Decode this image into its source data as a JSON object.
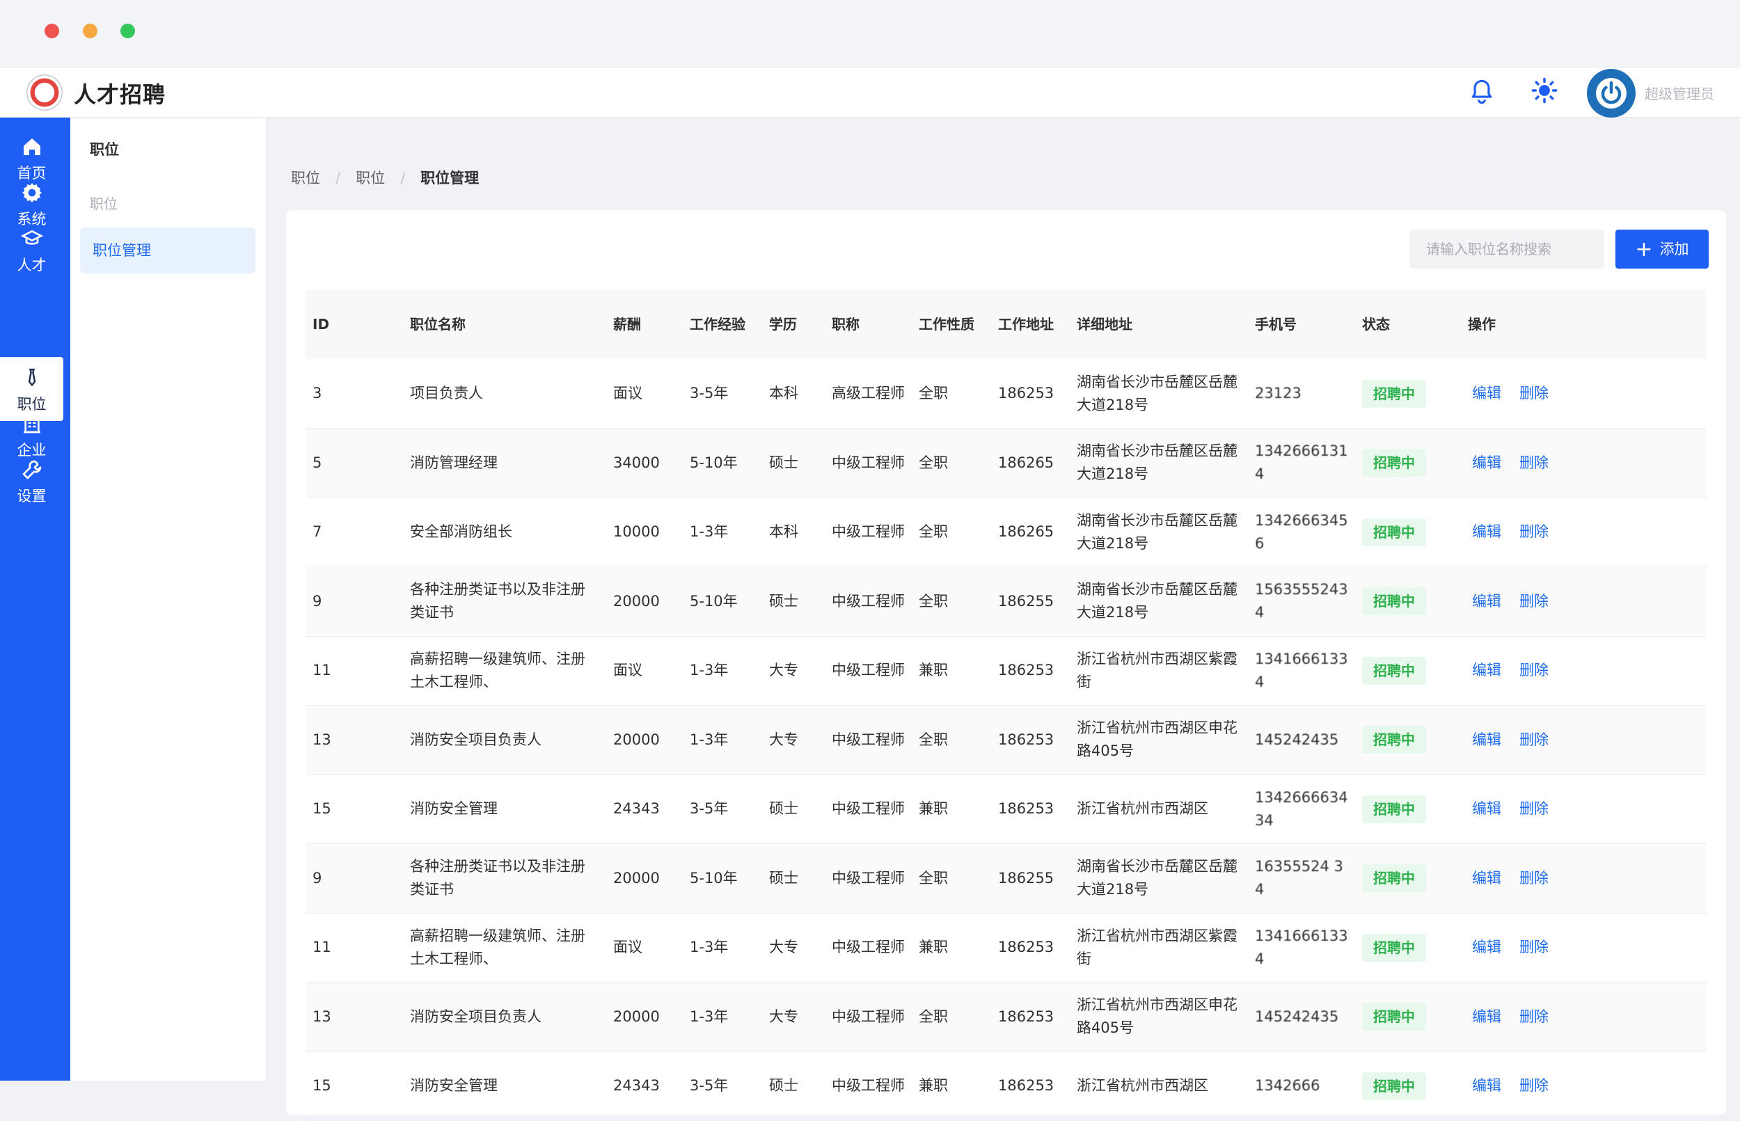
{
  "window": {
    "title": ""
  },
  "header": {
    "app_title": "人才招聘",
    "user_name": "超级管理员"
  },
  "rail": {
    "items": [
      {
        "label": "首页",
        "icon": "home-icon"
      },
      {
        "label": "系统",
        "icon": "gear-icon"
      },
      {
        "label": "人才",
        "icon": "graduation-cap-icon"
      },
      {
        "label": "职位",
        "icon": "tie-icon",
        "active": true
      },
      {
        "label": "企业",
        "icon": "building-icon"
      },
      {
        "label": "设置",
        "icon": "wrench-icon"
      }
    ]
  },
  "subnav": {
    "title": "职位",
    "group": "职位",
    "item": "职位管理"
  },
  "breadcrumb": [
    "职位",
    "职位",
    "职位管理"
  ],
  "toolbar": {
    "search_placeholder": "请输入职位名称搜索",
    "add_label": "添加"
  },
  "table": {
    "headers": [
      "ID",
      "职位名称",
      "薪酬",
      "工作经验",
      "学历",
      "职称",
      "工作性质",
      "工作地址",
      "详细地址",
      "手机号",
      "状态",
      "操作"
    ],
    "rows": [
      {
        "id": "3",
        "name": "项目负责人",
        "salary": "面议",
        "exp": "3-5年",
        "edu": "本科",
        "title": "高级工程师",
        "type": "全职",
        "city": "186253",
        "addr": "湖南省长沙市岳麓区岳麓大道218号",
        "phone": "23123",
        "status": "招聘中"
      },
      {
        "id": "5",
        "name": "消防管理经理",
        "salary": "34000",
        "exp": "5-10年",
        "edu": "硕士",
        "title": "中级工程师",
        "type": "全职",
        "city": "186265",
        "addr": "湖南省长沙市岳麓区岳麓大道218号",
        "phone": "13426661314",
        "status": "招聘中"
      },
      {
        "id": "7",
        "name": "安全部消防组长",
        "salary": "10000",
        "exp": "1-3年",
        "edu": "本科",
        "title": "中级工程师",
        "type": "全职",
        "city": "186265",
        "addr": "湖南省长沙市岳麓区岳麓大道218号",
        "phone": "13426663456",
        "status": "招聘中"
      },
      {
        "id": "9",
        "name": "各种注册类证书以及非注册类证书",
        "salary": "20000",
        "exp": "5-10年",
        "edu": "硕士",
        "title": "中级工程师",
        "type": "全职",
        "city": "186255",
        "addr": "湖南省长沙市岳麓区岳麓大道218号",
        "phone": "15635552434",
        "status": "招聘中"
      },
      {
        "id": "11",
        "name": "高薪招聘一级建筑师、注册土木工程师、",
        "salary": "面议",
        "exp": "1-3年",
        "edu": "大专",
        "title": "中级工程师",
        "type": "兼职",
        "city": "186253",
        "addr": "浙江省杭州市西湖区紫霞街",
        "phone": "13416661334",
        "status": "招聘中"
      },
      {
        "id": "13",
        "name": "消防安全项目负责人",
        "salary": "20000",
        "exp": "1-3年",
        "edu": "大专",
        "title": "中级工程师",
        "type": "全职",
        "city": "186253",
        "addr": "浙江省杭州市西湖区申花路405号",
        "phone": "145242435",
        "status": "招聘中"
      },
      {
        "id": "15",
        "name": "消防安全管理",
        "salary": "24343",
        "exp": "3-5年",
        "edu": "硕士",
        "title": "中级工程师",
        "type": "兼职",
        "city": "186253",
        "addr": "浙江省杭州市西湖区",
        "phone": "134266663434",
        "status": "招聘中"
      },
      {
        "id": "9",
        "name": "各种注册类证书以及非注册类证书",
        "salary": "20000",
        "exp": "5-10年",
        "edu": "硕士",
        "title": "中级工程师",
        "type": "全职",
        "city": "186255",
        "addr": "湖南省长沙市岳麓区岳麓大道218号",
        "phone": "16355524 34",
        "status": "招聘中"
      },
      {
        "id": "11",
        "name": "高薪招聘一级建筑师、注册土木工程师、",
        "salary": "面议",
        "exp": "1-3年",
        "edu": "大专",
        "title": "中级工程师",
        "type": "兼职",
        "city": "186253",
        "addr": "浙江省杭州市西湖区紫霞街",
        "phone": "13416661334",
        "status": "招聘中"
      },
      {
        "id": "13",
        "name": "消防安全项目负责人",
        "salary": "20000",
        "exp": "1-3年",
        "edu": "大专",
        "title": "中级工程师",
        "type": "全职",
        "city": "186253",
        "addr": "浙江省杭州市西湖区申花路405号",
        "phone": "145242435",
        "status": "招聘中"
      },
      {
        "id": "15",
        "name": "消防安全管理",
        "salary": "24343",
        "exp": "3-5年",
        "edu": "硕士",
        "title": "中级工程师",
        "type": "兼职",
        "city": "186253",
        "addr": "浙江省杭州市西湖区",
        "phone": "1342666",
        "status": "招聘中"
      }
    ],
    "ops": {
      "edit": "编辑",
      "delete": "删除"
    }
  },
  "colors": {
    "primary": "#1e5ef5",
    "badge_text": "#2fb14e",
    "badge_bg": "#e8f8ec"
  }
}
